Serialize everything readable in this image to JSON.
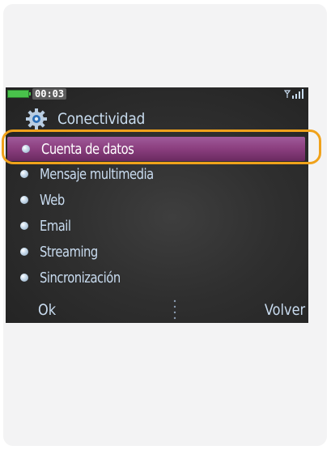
{
  "status_bar": {
    "time": "00:03",
    "battery_icon": "battery-icon",
    "signal_icon": "signal-icon"
  },
  "header": {
    "title": "Conectividad",
    "icon": "gear-icon"
  },
  "menu": {
    "items": [
      {
        "label": "Cuenta de datos",
        "selected": true
      },
      {
        "label": "Mensaje multimedia",
        "selected": false
      },
      {
        "label": "Web",
        "selected": false
      },
      {
        "label": "Email",
        "selected": false
      },
      {
        "label": "Streaming",
        "selected": false
      },
      {
        "label": "Sincronización",
        "selected": false
      }
    ]
  },
  "softkeys": {
    "left": "Ok",
    "right": "Volver"
  },
  "colors": {
    "highlight_ring": "#f0a21b",
    "selection": "#8a3e7e",
    "text": "#c9dcf0",
    "battery": "#49c24b"
  }
}
